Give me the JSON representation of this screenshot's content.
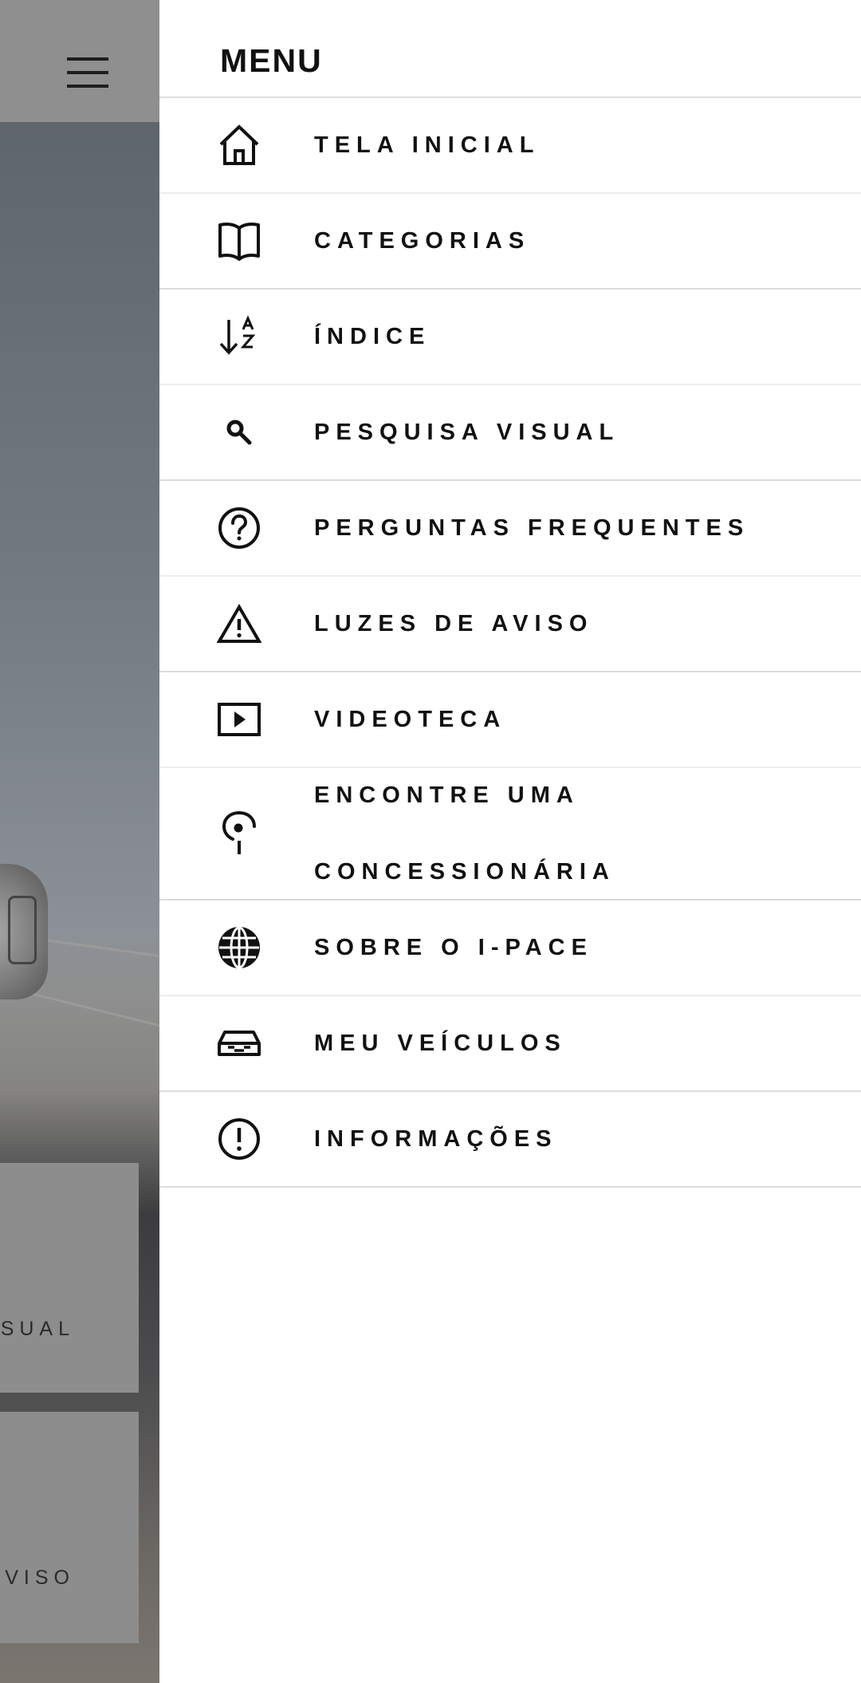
{
  "background": {
    "tiles": [
      {
        "label": "SUAL"
      },
      {
        "label": "VISO"
      }
    ]
  },
  "drawer": {
    "title": "MENU",
    "items": [
      {
        "label": "TELA INICIAL",
        "icon": "home-icon"
      },
      {
        "label": "CATEGORIAS",
        "icon": "book-icon"
      },
      {
        "label": "ÍNDICE",
        "icon": "sort-az-icon"
      },
      {
        "label": "PESQUISA VISUAL",
        "icon": "search-icon"
      },
      {
        "label": "PERGUNTAS FREQUENTES",
        "icon": "question-circle-icon"
      },
      {
        "label": "LUZES DE AVISO",
        "icon": "warning-triangle-icon"
      },
      {
        "label": "VIDEOTECA",
        "icon": "video-play-icon"
      },
      {
        "label_line1": "ENCONTRE UMA",
        "label_line2": "CONCESSIONÁRIA",
        "icon": "location-pin-icon"
      },
      {
        "label": "SOBRE O I-PACE",
        "icon": "globe-icon"
      },
      {
        "label": "MEU VEÍCULOS",
        "icon": "car-icon"
      },
      {
        "label": "INFORMAÇÕES",
        "icon": "info-exclamation-icon"
      }
    ]
  }
}
